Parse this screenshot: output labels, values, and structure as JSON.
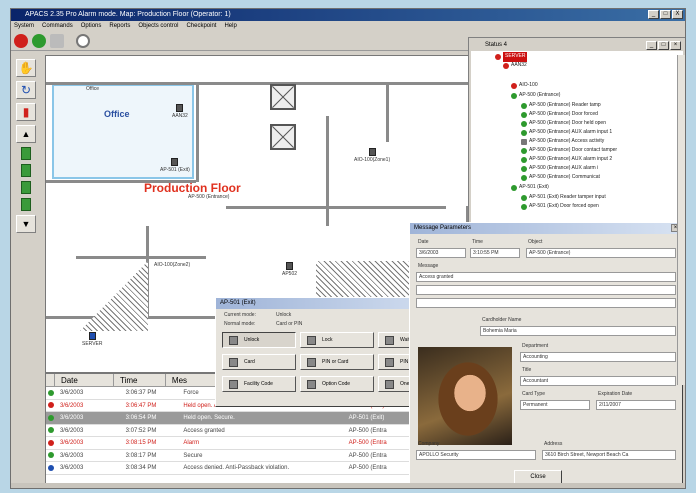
{
  "window": {
    "title": "APACS 2.35 Pro Alarm mode. Map: Production Floor (Operator: 1)",
    "buttons": [
      "_",
      "□",
      "X"
    ]
  },
  "menu": [
    "System",
    "Commands",
    "Options",
    "Reports",
    "Objects control",
    "Checkpoint",
    "Help"
  ],
  "floorplan": {
    "room_office": "Office",
    "room_production": "Production Floor",
    "devices": {
      "office_label": "Office",
      "aan": "AAN32",
      "ap501_exit": "AP-501 (Exit)",
      "ap500_entrance": "AP-500 (Entrance)",
      "aio_zone1": "AIO-100(Zone1)",
      "aio_zone2": "AIO-100(Zone2)",
      "ap502": "AP502",
      "server": "SERVER"
    }
  },
  "status_window": {
    "title": "Status 4",
    "tree": [
      "SERVER",
      "AAN32",
      "AIO-100",
      "AP-500 (Entrance)",
      "AP-500 (Entrance) Reader tamp",
      "AP-500 (Entrance) Door forced",
      "AP-500 (Entrance) Door held open",
      "AP-500 (Entrance) AUX alarm input 1",
      "AP-500 (Entrance) Access activity",
      "AP-500 (Entrance) Door contact tamper",
      "AP-500 (Entrance) AUX alarm input 2",
      "AP-500 (Entrance) AUX alarm i",
      "AP-500 (Entrance) Communicat",
      "AP-501 (Exit)",
      "AP-501 (Exit) Reader tamper input",
      "AP-501 (Exit) Door forced open"
    ]
  },
  "event_log": {
    "columns": [
      "Date",
      "Time",
      "Mes"
    ],
    "rows": [
      {
        "date": "3/6/2003",
        "time": "3:06:37 PM",
        "message": "Force",
        "object": "",
        "type": "normal"
      },
      {
        "date": "3/6/2003",
        "time": "3:06:47 PM",
        "message": "Held open. Alarm.",
        "object": "AP-501 (Exit)",
        "type": "alarm"
      },
      {
        "date": "3/6/2003",
        "time": "3:06:54 PM",
        "message": "Held open. Secure.",
        "object": "AP-501 (Exit)",
        "type": "selected"
      },
      {
        "date": "3/6/2003",
        "time": "3:07:52 PM",
        "message": "Access granted",
        "object": "AP-500 (Entra",
        "type": "normal"
      },
      {
        "date": "3/6/2003",
        "time": "3:08:15 PM",
        "message": "Alarm",
        "object": "AP-500 (Entra",
        "type": "alarm"
      },
      {
        "date": "3/6/2003",
        "time": "3:08:17 PM",
        "message": "Secure",
        "object": "AP-500 (Entra",
        "type": "normal"
      },
      {
        "date": "3/6/2003",
        "time": "3:08:34 PM",
        "message": "Access denied. Anti-Passback violation.",
        "object": "AP-500 (Entra",
        "type": "normal"
      }
    ]
  },
  "message_parameters": {
    "title": "Message Parameters",
    "date_label": "Date",
    "date_value": "3/6/2003",
    "time_label": "Time",
    "time_value": "3:10:55 PM",
    "object_label": "Object",
    "object_value": "AP-500 (Entrance)",
    "message_label": "Message",
    "message_value": "Access granted",
    "cardholder_label": "Cardholder Name",
    "cardholder_value": "Bohemia Maria",
    "department_label": "Department",
    "department_value": "Accounting",
    "title_label": "Title",
    "title_value": "Accountant",
    "card_type_label": "Card Type",
    "card_type_value": "Permanent",
    "expiration_label": "Expiration Date",
    "expiration_value": "2/11/2007",
    "company_label": "Company",
    "company_value": "APOLLO Security",
    "address_label": "Address",
    "address_value": "3610 Birch Street, Newport Beach Ca",
    "close_label": "Close"
  },
  "door_window": {
    "title": "AP-501 (Exit)",
    "current_mode_label": "Current mode:",
    "current_mode_value": "Unlock",
    "normal_mode_label": "Normal mode:",
    "normal_mode_value": "Card or PIN",
    "buttons": [
      "Unlock",
      "Lock",
      "Wait Mode",
      "Card",
      "PIN or Card",
      "PIN & Card",
      "Facility Code",
      "Option Code",
      "One Pass"
    ]
  },
  "colors": {
    "alarm": "#d0201b",
    "ok": "#2e9a2e",
    "accent": "#0a246a"
  }
}
